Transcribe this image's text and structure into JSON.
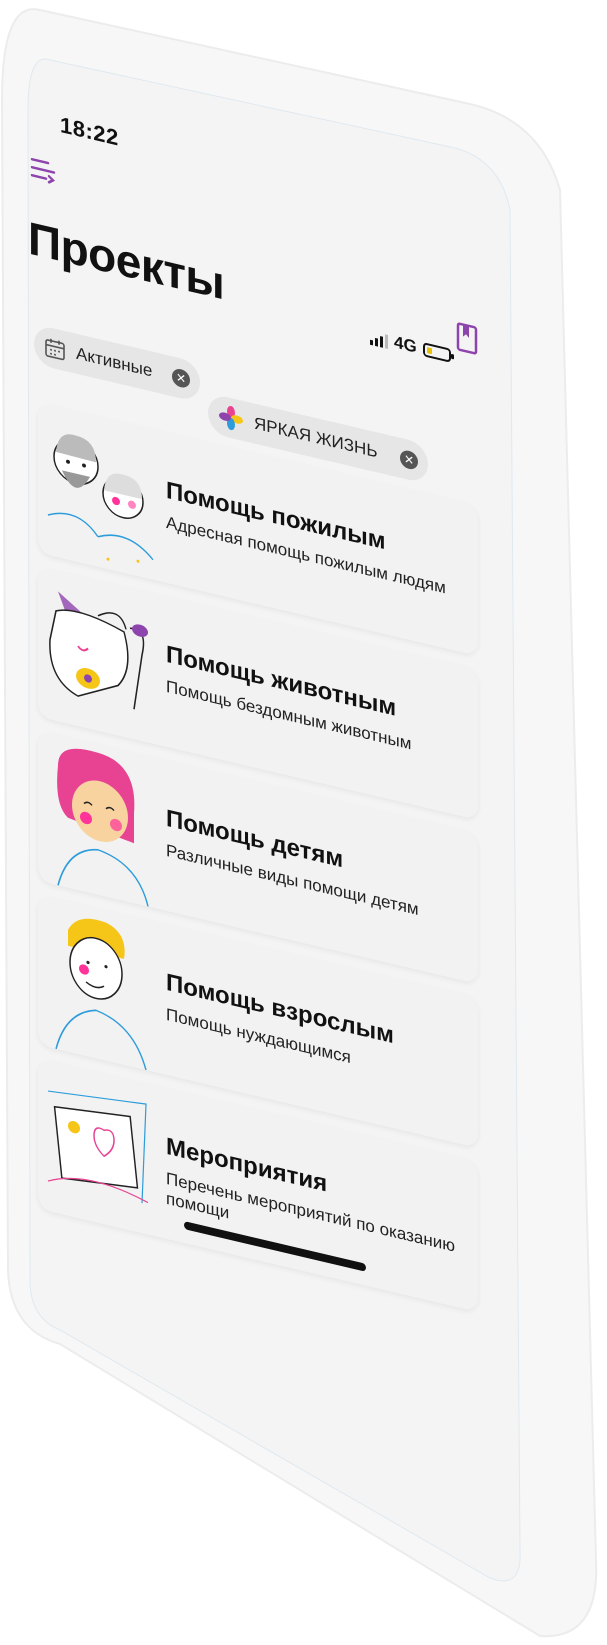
{
  "status": {
    "time": "18:22",
    "network": "4G"
  },
  "header": {
    "title": "Проекты"
  },
  "filters": {
    "active_label": "Активные",
    "org_label": "ЯРКАЯ ЖИЗНЬ"
  },
  "projects": [
    {
      "title": "Помощь пожилым",
      "desc": "Адресная помощь пожилым людям"
    },
    {
      "title": "Помощь животным",
      "desc": "Помощь бездомным животным"
    },
    {
      "title": "Помощь детям",
      "desc": "Различные виды помощи детям"
    },
    {
      "title": "Помощь взрослым",
      "desc": "Помощь нуждающимся"
    },
    {
      "title": "Мероприятия",
      "desc": "Перечень мероприятий по оказанию помощи"
    }
  ],
  "colors": {
    "accent": "#8e44ad",
    "background": "#f4f4f4"
  }
}
